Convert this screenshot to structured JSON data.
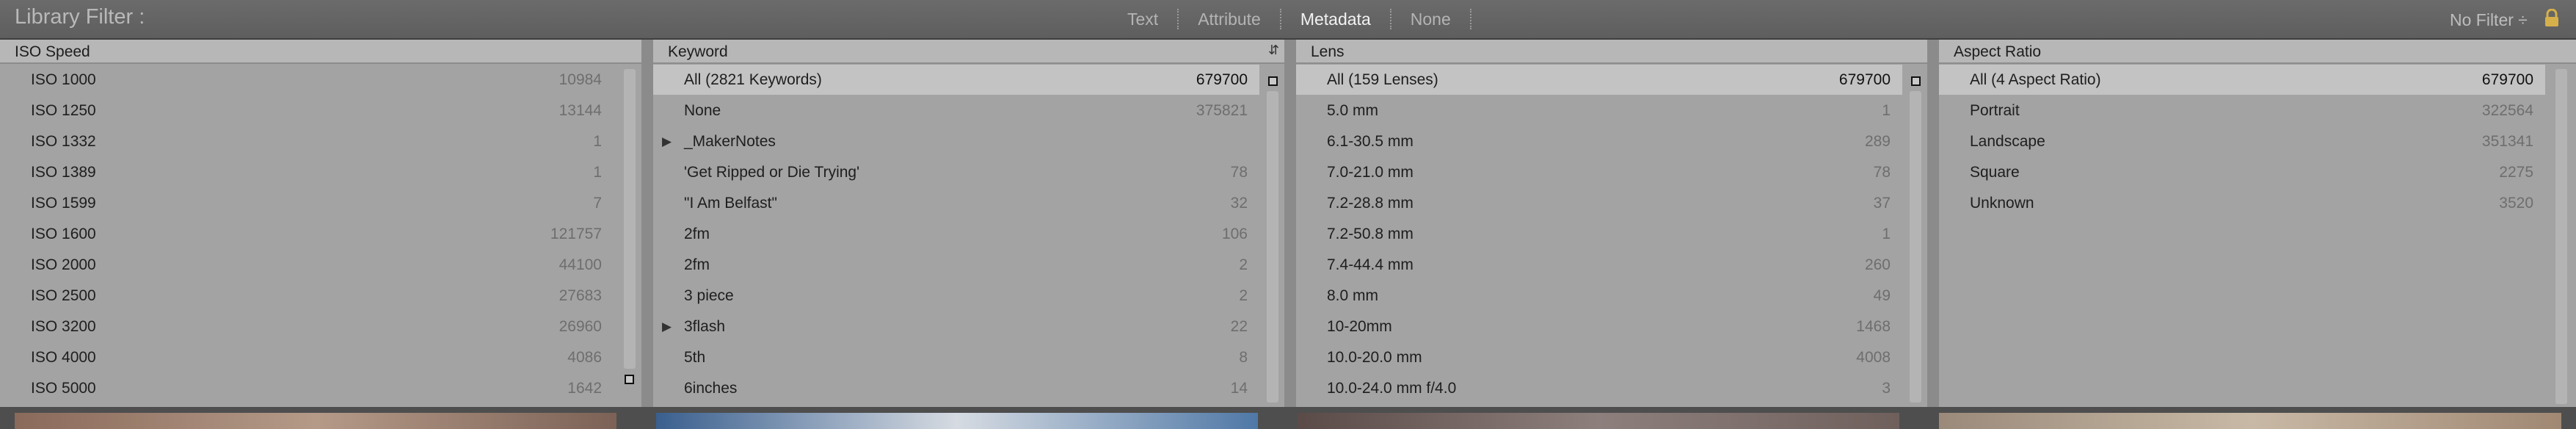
{
  "filter_bar": {
    "title": "Library Filter :",
    "modes": [
      "Text",
      "Attribute",
      "Metadata",
      "None"
    ],
    "active_mode": "Metadata",
    "preset": "No Filter ÷"
  },
  "columns": [
    {
      "header": "ISO Speed",
      "rows": [
        {
          "label": "ISO 1000",
          "count": "10984"
        },
        {
          "label": "ISO 1250",
          "count": "13144"
        },
        {
          "label": "ISO 1332",
          "count": "1"
        },
        {
          "label": "ISO 1389",
          "count": "1"
        },
        {
          "label": "ISO 1599",
          "count": "7"
        },
        {
          "label": "ISO 1600",
          "count": "121757"
        },
        {
          "label": "ISO 2000",
          "count": "44100"
        },
        {
          "label": "ISO 2500",
          "count": "27683"
        },
        {
          "label": "ISO 3200",
          "count": "26960"
        },
        {
          "label": "ISO 4000",
          "count": "4086"
        },
        {
          "label": "ISO 5000",
          "count": "1642"
        }
      ]
    },
    {
      "header": "Keyword",
      "rows": [
        {
          "label": "All (2821 Keywords)",
          "count": "679700"
        },
        {
          "label": "None",
          "count": "375821"
        },
        {
          "label": "_MakerNotes",
          "count": ""
        },
        {
          "label": "'Get Ripped or Die Trying'",
          "count": "78"
        },
        {
          "label": "\"I Am Belfast\"",
          "count": "32"
        },
        {
          "label": "2fm",
          "count": "106"
        },
        {
          "label": "2fm",
          "count": "2"
        },
        {
          "label": "3 piece",
          "count": "2"
        },
        {
          "label": "3flash",
          "count": "22"
        },
        {
          "label": "5th",
          "count": "8"
        },
        {
          "label": "6inches",
          "count": "14"
        }
      ]
    },
    {
      "header": "Lens",
      "rows": [
        {
          "label": "All (159 Lenses)",
          "count": "679700"
        },
        {
          "label": "5.0 mm",
          "count": "1"
        },
        {
          "label": "6.1-30.5 mm",
          "count": "289"
        },
        {
          "label": "7.0-21.0 mm",
          "count": "78"
        },
        {
          "label": "7.2-28.8 mm",
          "count": "37"
        },
        {
          "label": "7.2-50.8 mm",
          "count": "1"
        },
        {
          "label": "7.4-44.4 mm",
          "count": "260"
        },
        {
          "label": "8.0 mm",
          "count": "49"
        },
        {
          "label": "10-20mm",
          "count": "1468"
        },
        {
          "label": "10.0-20.0 mm",
          "count": "4008"
        },
        {
          "label": "10.0-24.0 mm f/4.0",
          "count": "3"
        }
      ]
    },
    {
      "header": "Aspect Ratio",
      "rows": [
        {
          "label": "All (4 Aspect Ratio)",
          "count": "679700"
        },
        {
          "label": "Portrait",
          "count": "322564"
        },
        {
          "label": "Landscape",
          "count": "351341"
        },
        {
          "label": "Square",
          "count": "2275"
        },
        {
          "label": "Unknown",
          "count": "3520"
        }
      ]
    }
  ],
  "icons": {
    "lock": "lock-icon",
    "sort": "sort-icon",
    "expand": "disclosure-triangle-icon"
  },
  "colors": {
    "panel_bg": "#a3a3a3",
    "header_bg": "#b7b7b7",
    "selected_row": "#c3c3c3",
    "top_bar": "#636363"
  }
}
